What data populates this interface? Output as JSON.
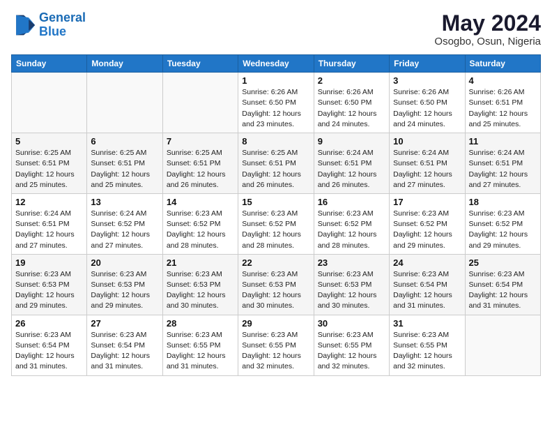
{
  "header": {
    "logo_line1": "General",
    "logo_line2": "Blue",
    "month_year": "May 2024",
    "location": "Osogbo, Osun, Nigeria"
  },
  "days_of_week": [
    "Sunday",
    "Monday",
    "Tuesday",
    "Wednesday",
    "Thursday",
    "Friday",
    "Saturday"
  ],
  "weeks": [
    [
      {
        "day": "",
        "info": ""
      },
      {
        "day": "",
        "info": ""
      },
      {
        "day": "",
        "info": ""
      },
      {
        "day": "1",
        "info": "Sunrise: 6:26 AM\nSunset: 6:50 PM\nDaylight: 12 hours\nand 23 minutes."
      },
      {
        "day": "2",
        "info": "Sunrise: 6:26 AM\nSunset: 6:50 PM\nDaylight: 12 hours\nand 24 minutes."
      },
      {
        "day": "3",
        "info": "Sunrise: 6:26 AM\nSunset: 6:50 PM\nDaylight: 12 hours\nand 24 minutes."
      },
      {
        "day": "4",
        "info": "Sunrise: 6:26 AM\nSunset: 6:51 PM\nDaylight: 12 hours\nand 25 minutes."
      }
    ],
    [
      {
        "day": "5",
        "info": "Sunrise: 6:25 AM\nSunset: 6:51 PM\nDaylight: 12 hours\nand 25 minutes."
      },
      {
        "day": "6",
        "info": "Sunrise: 6:25 AM\nSunset: 6:51 PM\nDaylight: 12 hours\nand 25 minutes."
      },
      {
        "day": "7",
        "info": "Sunrise: 6:25 AM\nSunset: 6:51 PM\nDaylight: 12 hours\nand 26 minutes."
      },
      {
        "day": "8",
        "info": "Sunrise: 6:25 AM\nSunset: 6:51 PM\nDaylight: 12 hours\nand 26 minutes."
      },
      {
        "day": "9",
        "info": "Sunrise: 6:24 AM\nSunset: 6:51 PM\nDaylight: 12 hours\nand 26 minutes."
      },
      {
        "day": "10",
        "info": "Sunrise: 6:24 AM\nSunset: 6:51 PM\nDaylight: 12 hours\nand 27 minutes."
      },
      {
        "day": "11",
        "info": "Sunrise: 6:24 AM\nSunset: 6:51 PM\nDaylight: 12 hours\nand 27 minutes."
      }
    ],
    [
      {
        "day": "12",
        "info": "Sunrise: 6:24 AM\nSunset: 6:51 PM\nDaylight: 12 hours\nand 27 minutes."
      },
      {
        "day": "13",
        "info": "Sunrise: 6:24 AM\nSunset: 6:52 PM\nDaylight: 12 hours\nand 27 minutes."
      },
      {
        "day": "14",
        "info": "Sunrise: 6:23 AM\nSunset: 6:52 PM\nDaylight: 12 hours\nand 28 minutes."
      },
      {
        "day": "15",
        "info": "Sunrise: 6:23 AM\nSunset: 6:52 PM\nDaylight: 12 hours\nand 28 minutes."
      },
      {
        "day": "16",
        "info": "Sunrise: 6:23 AM\nSunset: 6:52 PM\nDaylight: 12 hours\nand 28 minutes."
      },
      {
        "day": "17",
        "info": "Sunrise: 6:23 AM\nSunset: 6:52 PM\nDaylight: 12 hours\nand 29 minutes."
      },
      {
        "day": "18",
        "info": "Sunrise: 6:23 AM\nSunset: 6:52 PM\nDaylight: 12 hours\nand 29 minutes."
      }
    ],
    [
      {
        "day": "19",
        "info": "Sunrise: 6:23 AM\nSunset: 6:53 PM\nDaylight: 12 hours\nand 29 minutes."
      },
      {
        "day": "20",
        "info": "Sunrise: 6:23 AM\nSunset: 6:53 PM\nDaylight: 12 hours\nand 29 minutes."
      },
      {
        "day": "21",
        "info": "Sunrise: 6:23 AM\nSunset: 6:53 PM\nDaylight: 12 hours\nand 30 minutes."
      },
      {
        "day": "22",
        "info": "Sunrise: 6:23 AM\nSunset: 6:53 PM\nDaylight: 12 hours\nand 30 minutes."
      },
      {
        "day": "23",
        "info": "Sunrise: 6:23 AM\nSunset: 6:53 PM\nDaylight: 12 hours\nand 30 minutes."
      },
      {
        "day": "24",
        "info": "Sunrise: 6:23 AM\nSunset: 6:54 PM\nDaylight: 12 hours\nand 31 minutes."
      },
      {
        "day": "25",
        "info": "Sunrise: 6:23 AM\nSunset: 6:54 PM\nDaylight: 12 hours\nand 31 minutes."
      }
    ],
    [
      {
        "day": "26",
        "info": "Sunrise: 6:23 AM\nSunset: 6:54 PM\nDaylight: 12 hours\nand 31 minutes."
      },
      {
        "day": "27",
        "info": "Sunrise: 6:23 AM\nSunset: 6:54 PM\nDaylight: 12 hours\nand 31 minutes."
      },
      {
        "day": "28",
        "info": "Sunrise: 6:23 AM\nSunset: 6:55 PM\nDaylight: 12 hours\nand 31 minutes."
      },
      {
        "day": "29",
        "info": "Sunrise: 6:23 AM\nSunset: 6:55 PM\nDaylight: 12 hours\nand 32 minutes."
      },
      {
        "day": "30",
        "info": "Sunrise: 6:23 AM\nSunset: 6:55 PM\nDaylight: 12 hours\nand 32 minutes."
      },
      {
        "day": "31",
        "info": "Sunrise: 6:23 AM\nSunset: 6:55 PM\nDaylight: 12 hours\nand 32 minutes."
      },
      {
        "day": "",
        "info": ""
      }
    ]
  ]
}
